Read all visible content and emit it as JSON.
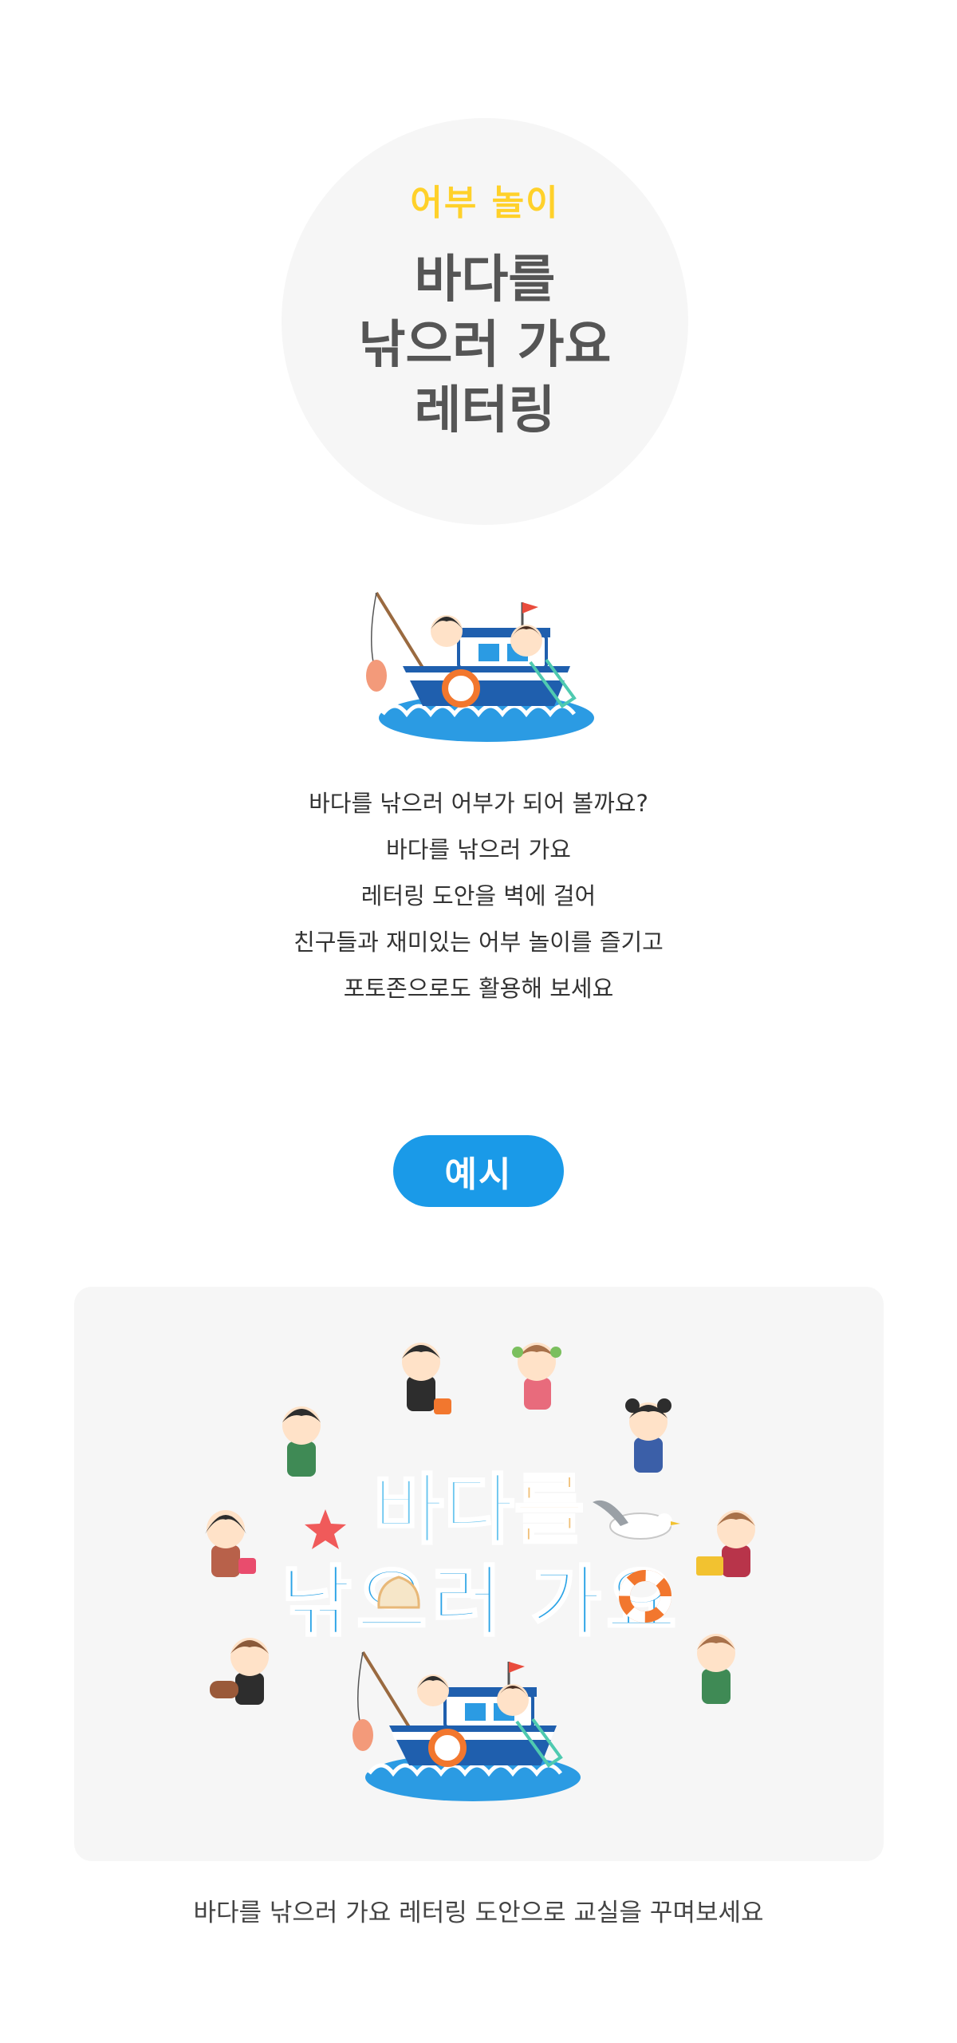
{
  "hero": {
    "subtitle": "어부 놀이",
    "title_lines": [
      "바다를",
      "낚으러 가요",
      "레터링"
    ]
  },
  "description": {
    "lines": [
      "바다를 낚으러 어부가 되어 볼까요?",
      "바다를 낚으러 가요",
      "레터링 도안을 벽에 걸어",
      "친구들과 재미있는 어부 놀이를 즐기고",
      "포토존으로도 활용해 보세요"
    ]
  },
  "example": {
    "label": "예시",
    "lettering_line1": [
      "바",
      "다",
      "를"
    ],
    "lettering_line2": [
      "낚",
      "으",
      "러",
      "가",
      "요"
    ]
  },
  "caption": "바다를 낚으러 가요 레터링 도안으로 교실을 꾸며보세요",
  "colors": {
    "subtitle_yellow": "#ffd12a",
    "title_gray": "#555555",
    "pill_blue": "#1a9ae8",
    "panel_bg": "#f6f6f6",
    "lettering_light_blue": "#6cc6ef",
    "lettering_blue": "#2aa3e6",
    "lettering_tan": "#f0c07a",
    "boat_blue": "#1f5fae",
    "wave_blue": "#2b9be3"
  },
  "icons": {
    "boat": "fishing-boat-illustration",
    "starfish": "starfish-icon",
    "seagull": "seagull-icon",
    "shell": "scallop-shell-icon",
    "lifebuoy": "lifebuoy-icon"
  }
}
